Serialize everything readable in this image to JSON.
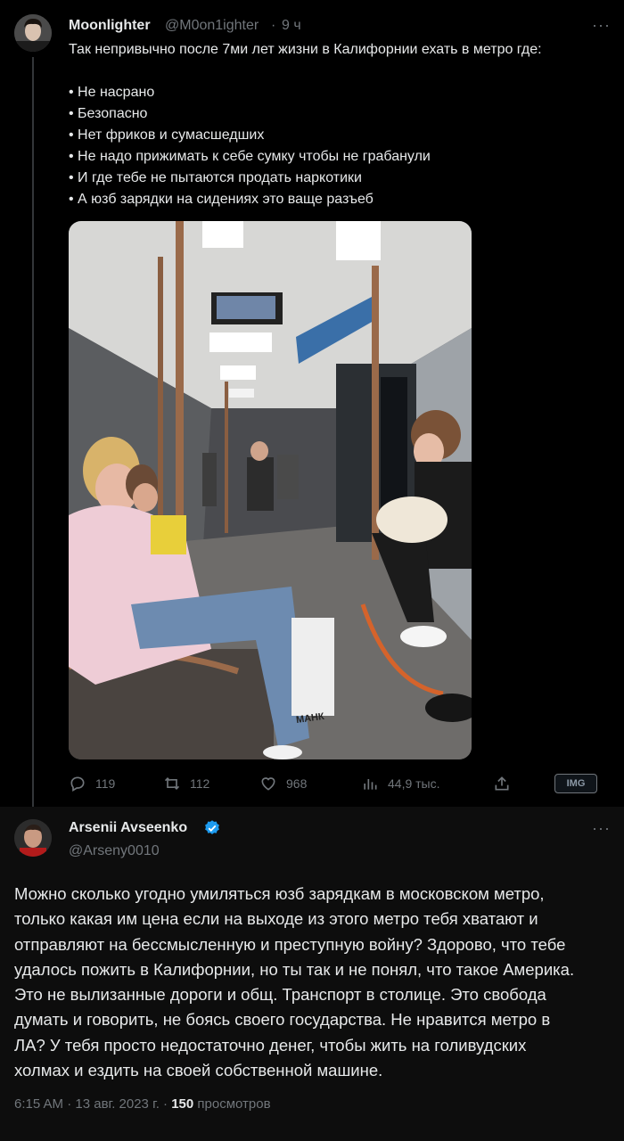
{
  "tweet1": {
    "author_name": "Moonlighter",
    "handle": "@M0on1ighter",
    "separator": "·",
    "time": "9 ч",
    "more_label": "···",
    "lines": [
      "Так непривычно после 7ми лет жизни в Калифорнии ехать в метро где:",
      "• Не насрано",
      "• Безопасно",
      "• Нет фриков и сумасшедших",
      "• Не надо прижимать к себе сумку чтобы не грабанули",
      "• И где тебе не пытаются продать наркотики",
      "• А юзб зарядки на сидениях это ваще разъеб"
    ],
    "photo_text": "МАНК",
    "actions": {
      "replies": "119",
      "reposts": "112",
      "likes": "968",
      "views": "44,9 тыс.",
      "badge": "IMG"
    }
  },
  "tweet2": {
    "author_name": "Arsenii Avseenko",
    "handle": "@Arseny0010",
    "more_label": "···",
    "lines": [
      "Можно сколько угодно умиляться юзб зарядкам в московском метро,",
      "только какая им цена если на выходе из этого метро тебя хватают и",
      "отправляют на бессмысленную и преступную войну? Здорово, что тебе",
      "удалось пожить в Калифорнии, но ты так и не понял, что такое Америка.",
      "Это не вылизанные дороги и общ. Транспорт в столице. Это свобода",
      "думать и говорить, не боясь своего государства. Не нравится метро в",
      "ЛА? У тебя просто недостаточно денег, чтобы жить на голивудских",
      "холмах и ездить на своей собственной машине."
    ],
    "meta": {
      "time": "6:15 AM",
      "separator": "·",
      "date": "13 авг. 2023 г.",
      "views_count": "150",
      "views_label": "просмотров"
    }
  },
  "colors": {
    "background": "#000000",
    "text": "#e7e9ea",
    "secondary": "#71767b",
    "verified": "#1d9bf0"
  }
}
